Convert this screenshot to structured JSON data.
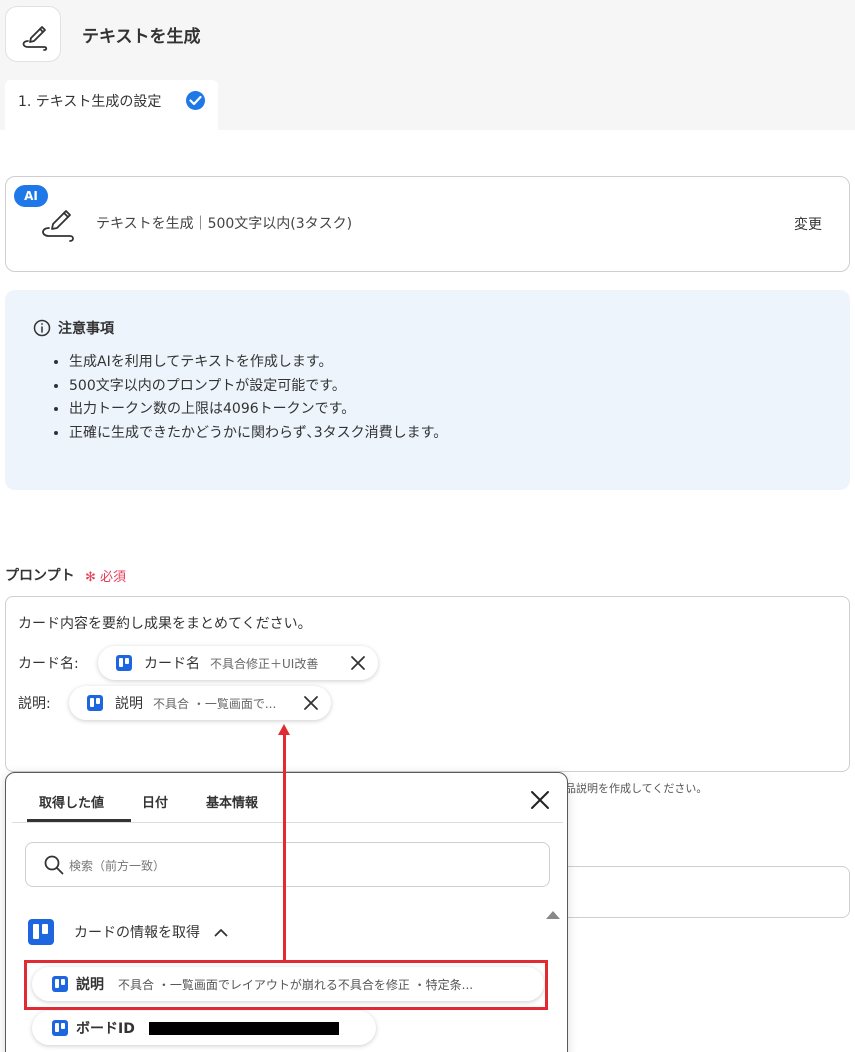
{
  "header": {
    "title": "テキストを生成"
  },
  "step_tab": {
    "label": "1. テキスト生成の設定"
  },
  "action": {
    "badge": "AI",
    "description": "テキストを生成｜500文字以内(3タスク)",
    "change_label": "変更"
  },
  "notice": {
    "title": "注意事項",
    "items": [
      "生成AIを利用してテキストを作成します。",
      "500文字以内のプロンプトが設定可能です。",
      "出力トークン数の上限は4096トークンです。",
      "正確に生成できたかどうかに関わらず､3タスク消費します。"
    ]
  },
  "prompt": {
    "label": "プロンプト",
    "required": "必須",
    "line1": "カード内容を要約し成果をまとめてください。",
    "card_name_prefix": "カード名:",
    "desc_prefix": "説明:",
    "chips": [
      {
        "name": "カード名",
        "value": "不具合修正＋UI改善"
      },
      {
        "name": "説明",
        "value": "不具合 ・一覧画面で..."
      }
    ]
  },
  "hint_text": "品説明を作成してください。",
  "picker": {
    "tabs": [
      "取得した値",
      "日付",
      "基本情報"
    ],
    "active_tab": "取得した値",
    "search_placeholder": "検索（前方一致）",
    "section_title": "カードの情報を取得",
    "items": [
      {
        "name": "説明",
        "value": "不具合 ・一覧画面でレイアウトが崩れる不具合を修正 ・特定条..."
      },
      {
        "name": "ボードID",
        "value": ""
      }
    ]
  },
  "colors": {
    "accent": "#1e78e8",
    "trello": "#1e66e0",
    "required": "#e83c5a",
    "annotation": "#e02b32",
    "notice_bg": "#edf4fc"
  }
}
